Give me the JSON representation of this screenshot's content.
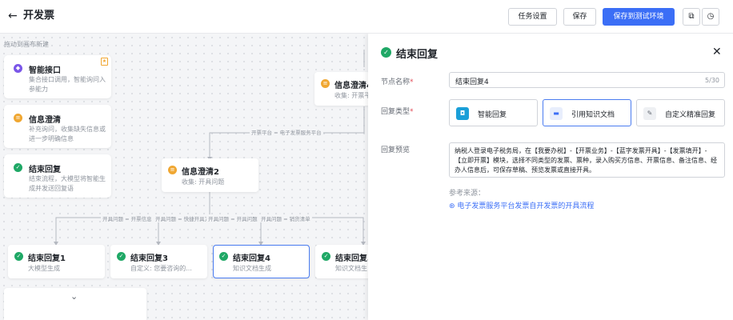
{
  "header": {
    "back_icon": "arrow-left-icon",
    "title": "开发票",
    "task_settings": "任务设置",
    "save": "保存",
    "save_to_test": "保存到测试环境"
  },
  "canvas": {
    "hint": "拖动到画布新建",
    "palette": [
      {
        "name": "智能接口",
        "desc": "集合接口调用，智能询问入参能力",
        "icon": "cube-icon",
        "color": "#7a56e8"
      },
      {
        "name": "信息澄清",
        "desc": "补充询问，收集缺失信息或进一步明确信息",
        "icon": "chat-icon",
        "color": "#f0a732"
      },
      {
        "name": "结束回复",
        "desc": "结束流程，大模型将智能生成并发送回复语",
        "icon": "check-circle-icon",
        "color": "#1fa866"
      }
    ],
    "nodes": {
      "clarify4": {
        "name": "信息澄清4",
        "sub": "收集: 开票平"
      },
      "clarify2": {
        "name": "信息澄清2",
        "sub": "收集: 开具问题"
      },
      "end1": {
        "name": "结束回复1",
        "sub": "大模型生成"
      },
      "end3": {
        "name": "结束回复3",
        "sub": "自定义: 您要咨询的..."
      },
      "end4": {
        "name": "结束回复4",
        "sub": "知识文档生成"
      },
      "end5": {
        "name": "结束回复5",
        "sub": "知识文档生"
      }
    },
    "edges": {
      "platform": "开票平台 = 电子发票服务平台",
      "e1": "开具问题 = 开票信息",
      "e2": "开具问题 = 快捷开具方",
      "e3": "开具问题 = 开具问题",
      "e4": "开具问题 = 销货清单"
    }
  },
  "panel": {
    "title": "结束回复",
    "node_name_label": "节点名称",
    "node_name_value": "结束回复4",
    "node_name_count": "5/30",
    "reply_type_label": "回复类型",
    "reply_types": [
      "智能回复",
      "引用知识文档",
      "自定义精准回复"
    ],
    "selected_reply_type": "引用知识文档",
    "preview_label": "回复预览",
    "preview_text": "纳税人登录电子税务局，在【我要办税】-【开票业务】-【蓝字发票开具】-【发票填开】-【立即开票】模块，选择不同类型的发票、票种，录入购买方信息、开票信息、备注信息、经办人信息后，可保存草稿、预览发票或直接开具。",
    "ref_label": "参考来源：",
    "ref_link": "电子发票服务平台发票自开发票的开具流程"
  }
}
